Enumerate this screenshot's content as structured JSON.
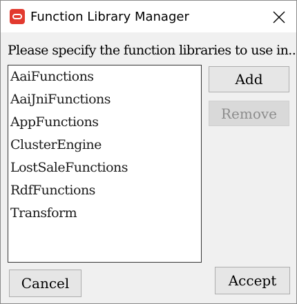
{
  "window": {
    "title": "Function Library Manager",
    "close_glyph": "close-icon"
  },
  "instruction": "Please specify the function libraries to use in...",
  "libraries": [
    "AaiFunctions",
    "AaiJniFunctions",
    "AppFunctions",
    "ClusterEngine",
    "LostSaleFunctions",
    "RdfFunctions",
    "Transform"
  ],
  "buttons": {
    "add": "Add",
    "remove": "Remove",
    "remove_enabled": false,
    "cancel": "Cancel",
    "accept": "Accept"
  },
  "colors": {
    "app_icon": "#e23a2f",
    "dialog_background": "#f0f0f0",
    "disabled_text": "#8c8c8c"
  }
}
